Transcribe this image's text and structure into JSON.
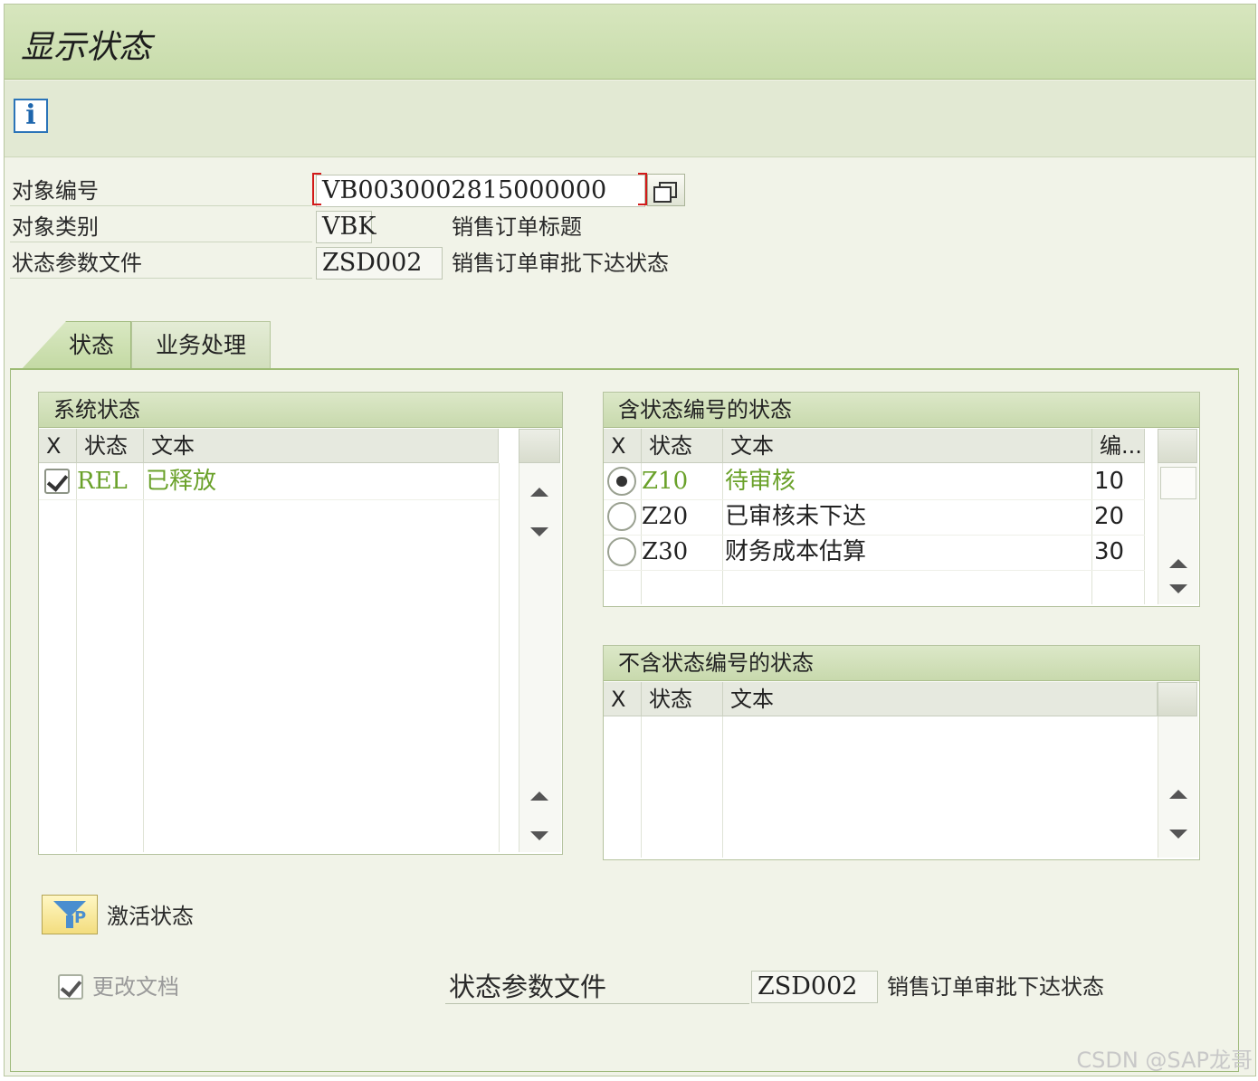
{
  "window": {
    "title": "显示状态"
  },
  "header": {
    "object_number_label": "对象编号",
    "object_number_value": "VB0030002815000000",
    "object_category_label": "对象类别",
    "object_category_value": "VBK",
    "object_category_desc": "销售订单标题",
    "status_profile_label": "状态参数文件",
    "status_profile_value": "ZSD002",
    "status_profile_desc": "销售订单审批下达状态"
  },
  "tabs": [
    {
      "label": "状态",
      "active": true
    },
    {
      "label": "业务处理",
      "active": false
    }
  ],
  "system_status": {
    "title": "系统状态",
    "columns": [
      "X",
      "状态",
      "文本"
    ],
    "rows": [
      {
        "checked": true,
        "status": "REL",
        "text": "已释放"
      }
    ]
  },
  "status_with_number": {
    "title": "含状态编号的状态",
    "columns": [
      "X",
      "状态",
      "文本",
      "编..."
    ],
    "rows": [
      {
        "selected": true,
        "status": "Z10",
        "text": "待审核",
        "number": "10"
      },
      {
        "selected": false,
        "status": "Z20",
        "text": "已审核未下达",
        "number": "20"
      },
      {
        "selected": false,
        "status": "Z30",
        "text": "财务成本估算",
        "number": "30"
      }
    ]
  },
  "status_without_number": {
    "title": "不含状态编号的状态",
    "columns": [
      "X",
      "状态",
      "文本"
    ],
    "rows": []
  },
  "activate": {
    "label": "激活状态"
  },
  "footer": {
    "change_docs_label": "更改文档",
    "change_docs_checked": true,
    "status_profile_label": "状态参数文件",
    "status_profile_value": "ZSD002",
    "status_profile_desc": "销售订单审批下达状态"
  },
  "watermark": "CSDN @SAP龙哥",
  "colors": {
    "title_bar": "#c8dcab",
    "highlight_green": "#6aa12a",
    "background": "#f1f3e8"
  }
}
